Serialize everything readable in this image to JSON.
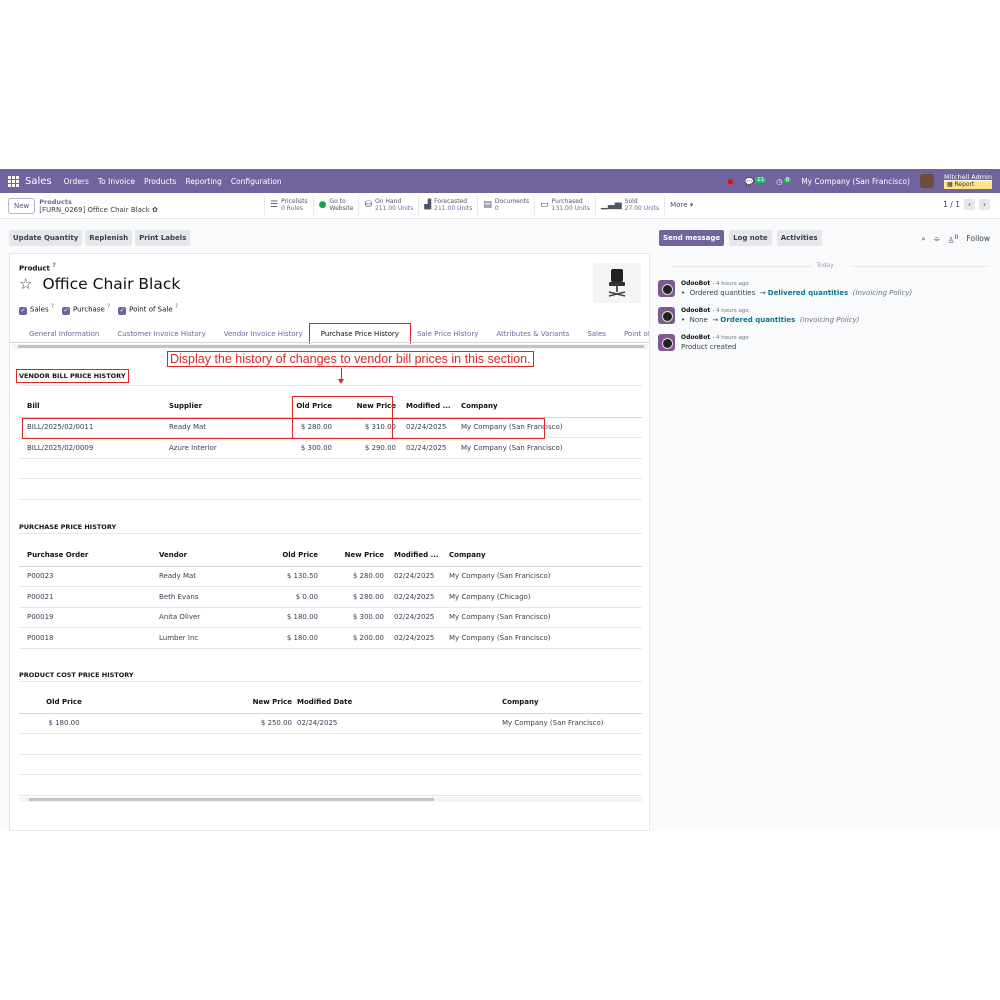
{
  "nav": {
    "brand": "Sales",
    "menu": [
      "Orders",
      "To Invoice",
      "Products",
      "Reporting",
      "Configuration"
    ],
    "messages_badge": "11",
    "activities_badge": "8",
    "company": "My Company (San Francisco)",
    "user": "Mitchell Admin",
    "db": "Report"
  },
  "control": {
    "new_label": "New",
    "breadcrumb_parent": "Products",
    "breadcrumb_current": "[FURN_0269] Office Chair Black",
    "pager": "1 / 1",
    "smart_buttons": [
      {
        "label": "Pricelists",
        "value": "0 Rules"
      },
      {
        "label": "Go to",
        "value": "Website"
      },
      {
        "label": "On Hand",
        "value": "211.00 Units"
      },
      {
        "label": "Forecasted",
        "value": "211.00 Units"
      },
      {
        "label": "Documents",
        "value": "0"
      },
      {
        "label": "Purchased",
        "value": "131.00 Units"
      },
      {
        "label": "Sold",
        "value": "27.00 Units"
      }
    ],
    "more_label": "More ▾"
  },
  "actions": [
    "Update Quantity",
    "Replenish",
    "Print Labels"
  ],
  "form": {
    "product_label": "Product",
    "help_mark": "?",
    "title": "Office Chair Black",
    "checks": [
      "Sales",
      "Purchase",
      "Point of Sale"
    ],
    "tabs": [
      "General Information",
      "Customer Invoice History",
      "Vendor Invoice History",
      "Purchase Price History",
      "Sale Price History",
      "Attributes & Variants",
      "Sales",
      "Point of Sale"
    ],
    "active_tab": "Purchase Price History"
  },
  "callout": "Display the history of changes to vendor bill prices in this section.",
  "vendor_bill": {
    "title": "VENDOR BILL PRICE HISTORY",
    "headers": [
      "Bill",
      "Supplier",
      "Old Price",
      "New Price",
      "Modified ...",
      "Company"
    ],
    "rows": [
      [
        "BILL/2025/02/0011",
        "Ready Mat",
        "$ 280.00",
        "$ 310.00",
        "02/24/2025",
        "My Company (San Francisco)"
      ],
      [
        "BILL/2025/02/0009",
        "Azure Interior",
        "$ 300.00",
        "$ 290.00",
        "02/24/2025",
        "My Company (San Francisco)"
      ]
    ]
  },
  "purchase_price": {
    "title": "PURCHASE PRICE HISTORY",
    "headers": [
      "Purchase Order",
      "Vendor",
      "Old Price",
      "New Price",
      "Modified ...",
      "Company"
    ],
    "rows": [
      [
        "P00023",
        "Ready Mat",
        "$ 130.50",
        "$ 280.00",
        "02/24/2025",
        "My Company (San Francisco)"
      ],
      [
        "P00021",
        "Beth Evans",
        "$ 0.00",
        "$ 280.00",
        "02/24/2025",
        "My Company (Chicago)"
      ],
      [
        "P00019",
        "Anita Oliver",
        "$ 180.00",
        "$ 300.00",
        "02/24/2025",
        "My Company (San Francisco)"
      ],
      [
        "P00018",
        "Lumber Inc",
        "$ 180.00",
        "$ 200.00",
        "02/24/2025",
        "My Company (San Francisco)"
      ]
    ]
  },
  "cost_price": {
    "title": "PRODUCT COST PRICE HISTORY",
    "headers": [
      "Old Price",
      "New Price",
      "Modified Date",
      "Company"
    ],
    "rows": [
      [
        "$ 180.00",
        "$ 250.00",
        "02/24/2025",
        "My Company (San Francisco)"
      ]
    ]
  },
  "chatter": {
    "send_message": "Send message",
    "log_note": "Log note",
    "activities": "Activities",
    "follow": "Follow",
    "followers_count": "0",
    "today": "Today",
    "messages": [
      {
        "author": "OdooBot",
        "time": "- 4 hours ago",
        "from": "Ordered quantities",
        "to": "Delivered quantities",
        "field": "(Invoicing Policy)"
      },
      {
        "author": "OdooBot",
        "time": "- 4 hours ago",
        "from": "None",
        "to": "Ordered quantities",
        "field": "(Invoicing Policy)"
      },
      {
        "author": "OdooBot",
        "time": "- 4 hours ago",
        "text": "Product created"
      }
    ]
  }
}
